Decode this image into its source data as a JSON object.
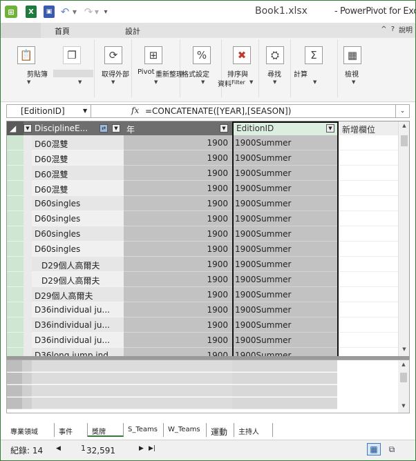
{
  "titlebar": {
    "app_icon": "powerpivot-icon",
    "excel_icon_label": "X",
    "save_icon_label": "▣",
    "undo": "↶",
    "redo": "↷",
    "document": "Book1.xlsx",
    "app": "- PowerPivot for Excel"
  },
  "ribbon_tabs": {
    "home": "首頁",
    "design": "設計",
    "help_glyph": "^",
    "help_icon": "?",
    "help_label": "說明"
  },
  "ribbon": {
    "clipboard": "剪貼簿",
    "get_external": "取得外部",
    "pivot": "Pivot",
    "refresh": "重新整理",
    "format": "格式設定",
    "sort_filter": "排序與",
    "sort_filter_sub1": "資料",
    "sort_filter_sub2": "Filter",
    "find": "尋找",
    "calc": "計算",
    "view": "檢視",
    "percent": "%",
    "sigma": "Σ"
  },
  "formula_bar": {
    "name_box": "[EditionID]",
    "fx": "fx",
    "formula": "=CONCATENATE([YEAR],[SEASON])",
    "expand": "⌄"
  },
  "columns": {
    "discipline": "DisciplineE...",
    "year": "年",
    "edition": "EditionID",
    "add": "新增欄位"
  },
  "rows": [
    {
      "discipline": "D60混雙",
      "year": "1900",
      "edition": "1900Summer"
    },
    {
      "discipline": "D60混雙",
      "year": "1900",
      "edition": "1900Summer"
    },
    {
      "discipline": "D60混雙",
      "year": "1900",
      "edition": "1900Summer"
    },
    {
      "discipline": "D60混雙",
      "year": "1900",
      "edition": "1900Summer"
    },
    {
      "discipline": "D60singles",
      "year": "1900",
      "edition": "1900Summer"
    },
    {
      "discipline": "D60singles",
      "year": "1900",
      "edition": "1900Summer"
    },
    {
      "discipline": "D60singles",
      "year": "1900",
      "edition": "1900Summer"
    },
    {
      "discipline": "D60singles",
      "year": "1900",
      "edition": "1900Summer"
    },
    {
      "discipline": "D29個人高爾夫",
      "year": "1900",
      "edition": "1900Summer"
    },
    {
      "discipline": "D29個人高爾夫",
      "year": "1900",
      "edition": "1900Summer"
    },
    {
      "discipline": "D29個人高爾夫",
      "year": "1900",
      "edition": "1900Summer"
    },
    {
      "discipline": "D36individual ju...",
      "year": "1900",
      "edition": "1900Summer"
    },
    {
      "discipline": "D36individual ju...",
      "year": "1900",
      "edition": "1900Summer"
    },
    {
      "discipline": "D36individual ju...",
      "year": "1900",
      "edition": "1900Summer"
    },
    {
      "discipline": "D36long jump ind...",
      "year": "1900",
      "edition": "1900Summer"
    }
  ],
  "sheet_tabs": [
    "專業領域",
    "事件",
    "獎牌",
    "S_Teams",
    "W_Teams",
    "運動",
    "主持人"
  ],
  "active_sheet": "獎牌",
  "status": {
    "record_label": "紀錄: 14",
    "record_current": "",
    "record_of": "1",
    "record_total": "32,591"
  }
}
